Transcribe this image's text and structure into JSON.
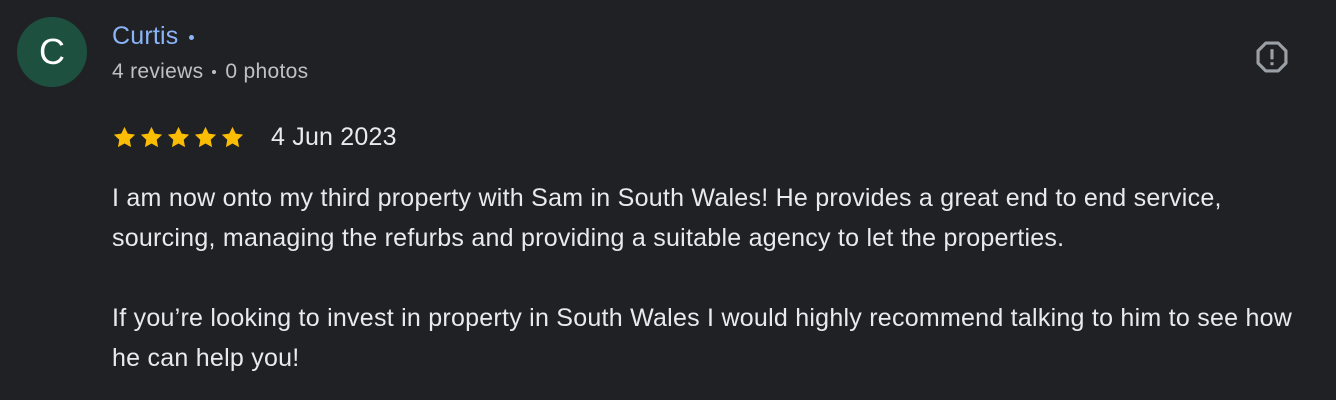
{
  "reviewer": {
    "avatar_letter": "C",
    "avatar_color": "#1e5040",
    "name": "Curtis",
    "reviews": "4 reviews",
    "photos": "0 photos"
  },
  "review": {
    "rating": 5,
    "rating_max": 5,
    "star_color": "#fbbc04",
    "date": "4 Jun 2023",
    "paragraphs": [
      "I am now onto my third property with Sam in South Wales! He provides a great end to end service, sourcing, managing the refurbs and providing a suitable agency to let the properties.",
      "If you’re looking to invest in property in South Wales I would highly recommend talking to him to see how he can help you!"
    ]
  },
  "actions": {
    "report_icon": "report-icon"
  },
  "colors": {
    "background": "#202124",
    "link": "#8ab4f8",
    "text": "#e8eaed",
    "secondary_text": "#bdc1c6"
  }
}
